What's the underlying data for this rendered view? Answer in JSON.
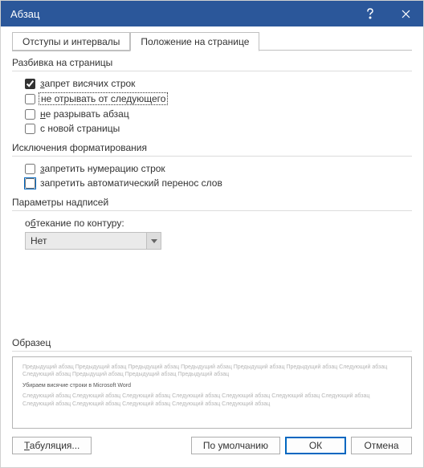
{
  "window": {
    "title": "Абзац"
  },
  "tabs": {
    "indent": "Отступы и интервалы",
    "position": "Положение на странице"
  },
  "sections": {
    "pagination": "Разбивка на страницы",
    "formatting_exceptions": "Исключения форматирования",
    "textbox_options": "Параметры надписей",
    "preview": "Образец"
  },
  "checkboxes": {
    "widow_control": "запрет висячих строк",
    "keep_with_next": "не отрывать от следующего",
    "keep_lines_together": "не разрывать абзац",
    "page_break_before": "с новой страницы",
    "suppress_line_numbers": "запретить нумерацию строк",
    "dont_hyphenate": "запретить автоматический перенос слов"
  },
  "dropdown": {
    "wrap_label": "обтекание по контуру:",
    "wrap_value": "Нет"
  },
  "preview": {
    "before": "Предыдущий абзац Предыдущий абзац Предыдущий абзац Предыдущий абзац Предыдущий абзац Предыдущий абзац Следующий абзац Следующий абзац Предыдущий абзац Предыдущий абзац Предыдущий абзац",
    "sample": "Убираем висячие строки в Microsoft Word",
    "after": "Следующий абзац Следующий абзац Следующий абзац Следующий абзац Следующий абзац Следующий абзац Следующий абзац Следующий абзац Следующий абзац Следующий абзац Следующий абзац Следующий абзац"
  },
  "buttons": {
    "tabs": "Табуляция...",
    "set_default": "По умолчанию",
    "ok": "ОК",
    "cancel": "Отмена"
  }
}
